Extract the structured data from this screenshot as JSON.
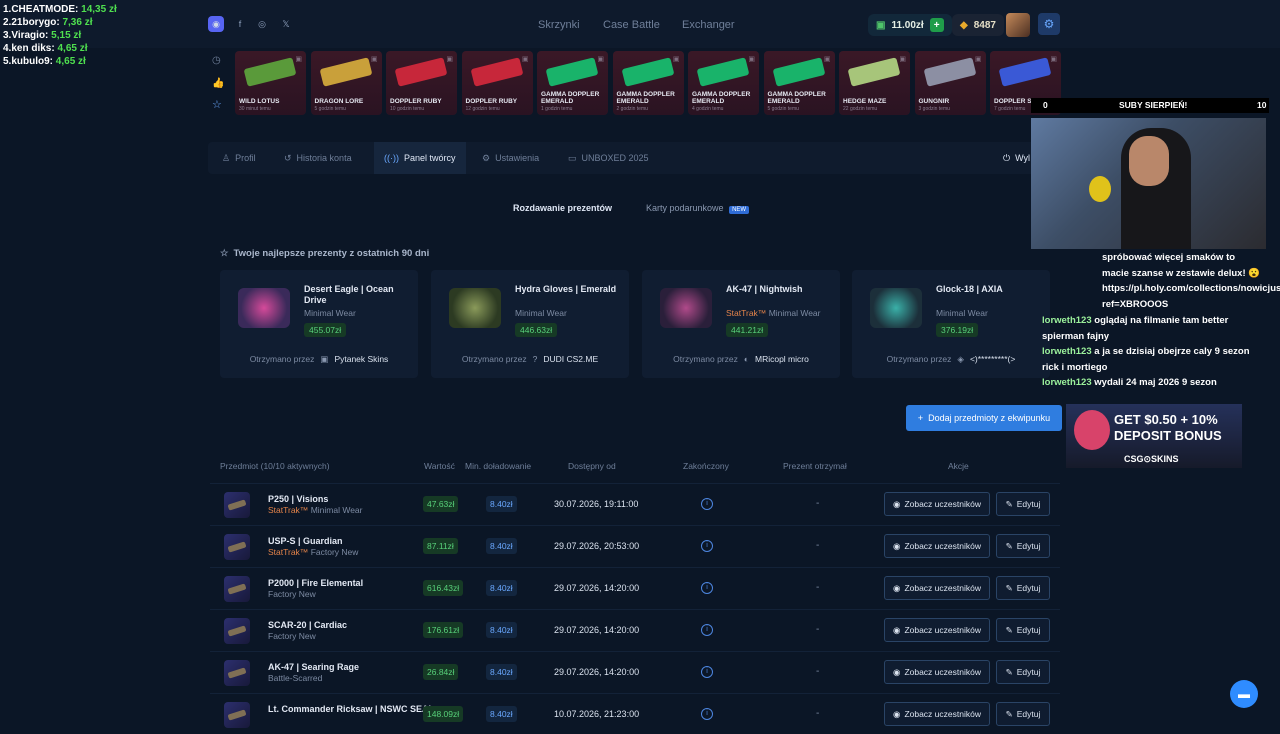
{
  "leaderboard": [
    {
      "name": "1.CHEATMODE:",
      "value": "14,35 zł"
    },
    {
      "name": "2.21borygo:",
      "value": "7,36 zł"
    },
    {
      "name": "3.Viragio:",
      "value": "5,15 zł"
    },
    {
      "name": "4.ken diks:",
      "value": "4,65 zł"
    },
    {
      "name": "5.kubulo9:",
      "value": "4,65 zł"
    }
  ],
  "nav": {
    "links": [
      "Skrzynki",
      "Case Battle",
      "Exchanger"
    ]
  },
  "header": {
    "balance": "11.00zł",
    "points": "8487"
  },
  "drops": [
    {
      "name": "WILD LOTUS",
      "sub": "30 minut temu",
      "color": "#5a9a3a"
    },
    {
      "name": "DRAGON LORE",
      "sub": "5 godzin temu",
      "color": "#c9a03a"
    },
    {
      "name": "DOPPLER RUBY",
      "sub": "10 godzin temu",
      "color": "#c7273a"
    },
    {
      "name": "DOPPLER RUBY",
      "sub": "12 godzin temu",
      "color": "#c7273a"
    },
    {
      "name": "GAMMA DOPPLER EMERALD",
      "sub": "1 godzin temu",
      "color": "#19b36a"
    },
    {
      "name": "GAMMA DOPPLER EMERALD",
      "sub": "2 godzin temu",
      "color": "#19b36a"
    },
    {
      "name": "GAMMA DOPPLER EMERALD",
      "sub": "4 godzin temu",
      "color": "#19b36a"
    },
    {
      "name": "GAMMA DOPPLER EMERALD",
      "sub": "5 godzin temu",
      "color": "#19b36a"
    },
    {
      "name": "HEDGE MAZE",
      "sub": "22 godzin temu",
      "color": "#a7c57a"
    },
    {
      "name": "GUNGNIR",
      "sub": "3 godzin temu",
      "color": "#8c8fa3"
    },
    {
      "name": "DOPPLER SAPPHIRE",
      "sub": "7 godzin temu",
      "color": "#3a59d6"
    }
  ],
  "tabs": [
    "Profil",
    "Historia konta",
    "Panel twórcy",
    "Ustawienia",
    "UNBOXED 2025",
    "Wyl"
  ],
  "subtabs": {
    "first": "Rozdawanie prezentów",
    "second": "Karty podarunkowe",
    "badge": "NEW"
  },
  "gifts_title": "Twoje najlepsze prezenty z ostatnich 90 dni",
  "received_label": "Otrzymano przez",
  "gifts": [
    {
      "name": "Desert Eagle | Ocean Drive",
      "cond": "Minimal Wear",
      "price": "455.07zł",
      "user": "Pytanek Skins",
      "color": "#d54a9a"
    },
    {
      "name": "Hydra Gloves | Emerald",
      "cond": "Minimal Wear",
      "price": "446.63zł",
      "user": "DUDI CS2.ME",
      "color": "#5a6b3a"
    },
    {
      "name": "AK-47 | Nightwish",
      "cond_prefix": "StatTrak™",
      "cond": "Minimal Wear",
      "price": "441.21zł",
      "user": "MRicopl micro",
      "color": "#8a3ab0"
    },
    {
      "name": "Glock-18 | AXIA",
      "cond": "Minimal Wear",
      "price": "376.19zł",
      "user": "<)*********(>",
      "color": "#3ab0a8"
    }
  ],
  "add_button": "Dodaj przedmioty z ekwipunku",
  "table": {
    "headers": [
      "Przedmiot (10/10 aktywnych)",
      "Wartość",
      "Min. doładowanie",
      "Dostępny od",
      "Zakończony",
      "Prezent otrzymał",
      "Akcje"
    ],
    "view_label": "Zobacz uczestników",
    "edit_label": "Edytuj",
    "rows": [
      {
        "name": "P250 | Visions",
        "st": "StatTrak™",
        "cond": "Minimal Wear",
        "value": "47.63zł",
        "min": "8.40zł",
        "date": "30.07.2026, 19:11:00",
        "recv": "-"
      },
      {
        "name": "USP-S | Guardian",
        "st": "StatTrak™",
        "cond": "Factory New",
        "value": "87.11zł",
        "min": "8.40zł",
        "date": "29.07.2026, 20:53:00",
        "recv": "-"
      },
      {
        "name": "P2000 | Fire Elemental",
        "st": "",
        "cond": "Factory New",
        "value": "616.43zł",
        "min": "8.40zł",
        "date": "29.07.2026, 14:20:00",
        "recv": "-"
      },
      {
        "name": "SCAR-20 | Cardiac",
        "st": "",
        "cond": "Factory New",
        "value": "176.61zł",
        "min": "8.40zł",
        "date": "29.07.2026, 14:20:00",
        "recv": "-"
      },
      {
        "name": "AK-47 | Searing Rage",
        "st": "",
        "cond": "Battle-Scarred",
        "value": "26.84zł",
        "min": "8.40zł",
        "date": "29.07.2026, 14:20:00",
        "recv": "-"
      },
      {
        "name": "Lt. Commander Ricksaw | NSWC SEAL",
        "st": "",
        "cond": "",
        "value": "148.09zł",
        "min": "8.40zł",
        "date": "10.07.2026, 21:23:00",
        "recv": "-"
      }
    ]
  },
  "stream": {
    "subs_count": "0",
    "subs_label": "SUBY SIERPIEŃ!",
    "subs_goal": "10",
    "chat_top": "spróbować więcej smaków to macie szanse w zestawie delux! 😮 https://pl.holy.com/collections/nowicjusze/?ref=XBROOOS",
    "chat": [
      {
        "user": "lorweth123",
        "msg": "oglądaj na filmanie tam better spierman fajny"
      },
      {
        "user": "lorweth123",
        "msg": "a ja se dzisiaj obejrze caly 9 sezon rick i mortiego"
      },
      {
        "user": "lorweth123",
        "msg": "wydali 24 maj 2026 9 sezon"
      }
    ],
    "promo_line1": "GET $0.50 + 10%",
    "promo_line2": "DEPOSIT BONUS",
    "promo_brand": "CSG⊙SKINS"
  }
}
